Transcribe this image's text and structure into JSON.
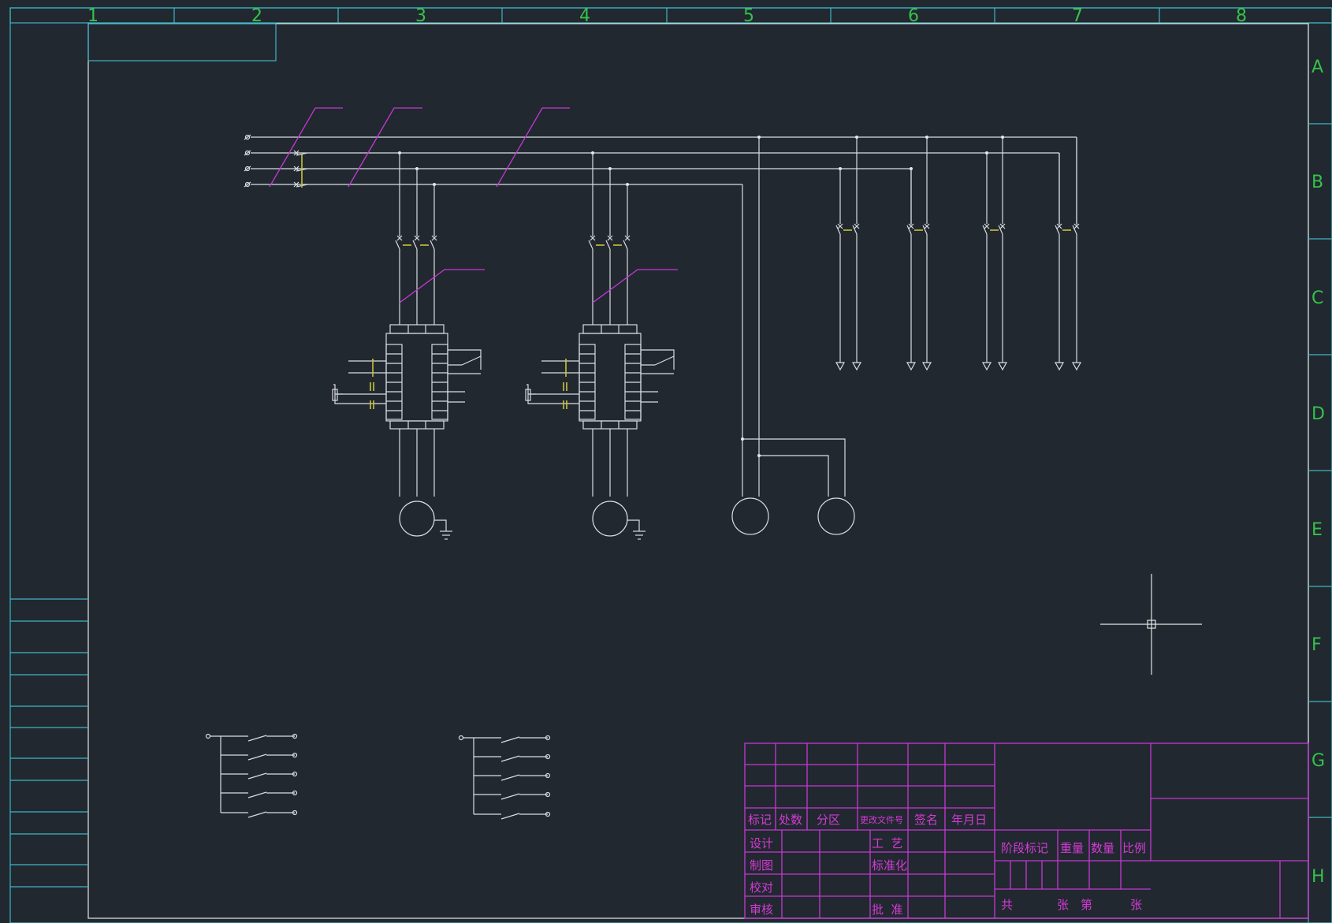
{
  "drawing": {
    "zone_columns": [
      "1",
      "2",
      "3",
      "4",
      "5",
      "6",
      "7",
      "8"
    ],
    "zone_rows": [
      "A",
      "B",
      "C",
      "D",
      "E",
      "F",
      "G",
      "H"
    ],
    "colors": {
      "background": "#212830",
      "frame": "#3fb6c4",
      "wire": "#d9dde2",
      "breaker_link": "#c737d4",
      "contact": "#c9c33a",
      "zone_label": "#35c24a",
      "title_block": "#d63ad6"
    }
  },
  "title_block": {
    "header": {
      "mark": "标记",
      "count": "处数",
      "zone": "分区",
      "change_doc": "更改文件号",
      "signature": "签名",
      "date": "年月日"
    },
    "roles": {
      "design": "设计",
      "drafting": "制图",
      "proofread": "校对",
      "review": "审核",
      "process": "工  艺",
      "standardization": "标准化",
      "approval": "批  准"
    },
    "info": {
      "stage_mark": "阶段标记",
      "weight": "重量",
      "quantity": "数量",
      "scale": "比例",
      "total": "共",
      "sheets": "张",
      "sheet_no": "第",
      "sheet": "张"
    }
  }
}
